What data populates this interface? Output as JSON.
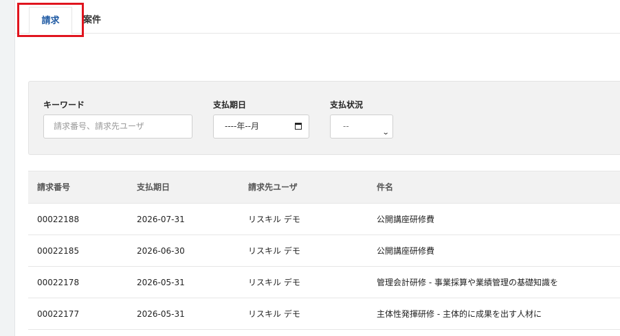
{
  "tabs": [
    {
      "label": "請求",
      "active": true
    },
    {
      "label": "案件",
      "active": false
    }
  ],
  "filters": {
    "keyword": {
      "label": "キーワード",
      "placeholder": "請求番号、請求先ユーザ"
    },
    "due_date": {
      "label": "支払期日",
      "value": "----年--月"
    },
    "status": {
      "label": "支払状況",
      "selected": "--"
    }
  },
  "table": {
    "headers": [
      "請求番号",
      "支払期日",
      "請求先ユーザ",
      "件名"
    ],
    "rows": [
      {
        "number": "00022188",
        "due": "2026-07-31",
        "user": "リスキル デモ",
        "subject": "公開講座研修費"
      },
      {
        "number": "00022185",
        "due": "2026-06-30",
        "user": "リスキル デモ",
        "subject": "公開講座研修費"
      },
      {
        "number": "00022178",
        "due": "2026-05-31",
        "user": "リスキル デモ",
        "subject": "管理会計研修 - 事業採算や業績管理の基礎知識を"
      },
      {
        "number": "00022177",
        "due": "2026-05-31",
        "user": "リスキル デモ",
        "subject": "主体性発揮研修 - 主体的に成果を出す人材に"
      }
    ]
  },
  "colors": {
    "accent": "#1f5aa3",
    "highlight": "#e0141e",
    "panel": "#f2f2f2"
  }
}
